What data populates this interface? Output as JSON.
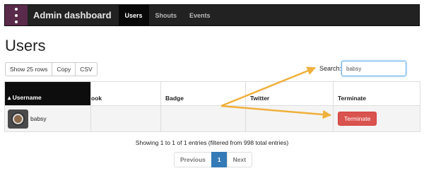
{
  "navbar": {
    "brand": "Admin dashboard",
    "items": [
      {
        "label": "Users",
        "active": true
      },
      {
        "label": "Shouts",
        "active": false
      },
      {
        "label": "Events",
        "active": false
      }
    ]
  },
  "page": {
    "title": "Users"
  },
  "toolbar": {
    "buttons": [
      "Show 25 rows",
      "Copy",
      "CSV"
    ]
  },
  "search": {
    "label": "Search:",
    "value": "babsy"
  },
  "table": {
    "columns": [
      "▴ Username",
      "ook",
      "Badge",
      "Twitter",
      "Terminate"
    ],
    "rows": [
      {
        "username": "babsy",
        "facebook": "",
        "badge": "",
        "twitter": "",
        "action": "Terminate"
      }
    ]
  },
  "info": "Showing 1 to 1 of 1 entries (filtered from 998 total entries)",
  "pagination": {
    "previous": "Previous",
    "current": "1",
    "next": "Next"
  },
  "colors": {
    "navbar": "#222222",
    "logo": "#5a2a4a",
    "danger": "#d9534f",
    "primary": "#337ab7",
    "arrow": "#f0b03c"
  }
}
